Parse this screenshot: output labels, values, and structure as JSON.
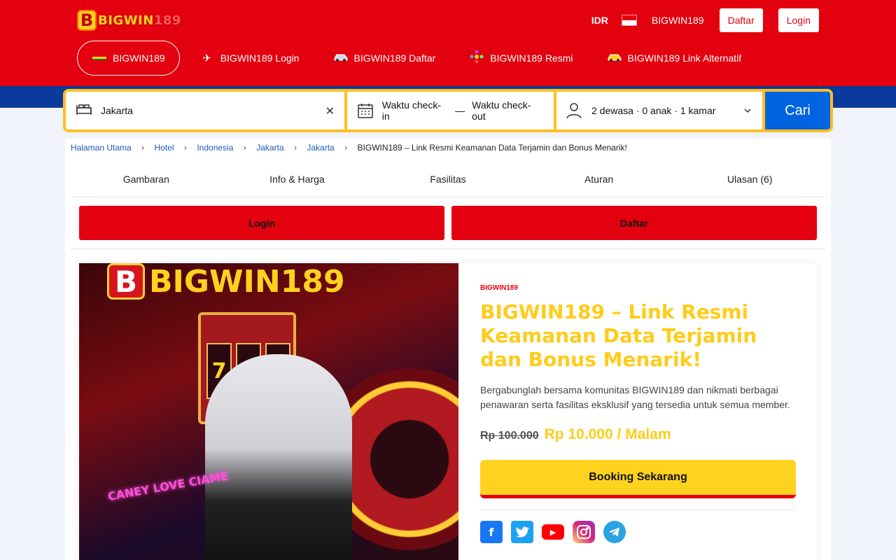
{
  "header": {
    "logo_text": "BIGWIN",
    "logo_number": "189",
    "currency": "IDR",
    "site_name": "BIGWIN189",
    "daftar_label": "Daftar",
    "login_label": "Login",
    "background_color": "#e3000f"
  },
  "nav": {
    "items": [
      {
        "label": "BIGWIN189",
        "icon": "flag-icon",
        "active": true
      },
      {
        "label": "BIGWIN189 Login",
        "icon": "airplane-icon"
      },
      {
        "label": "BIGWIN189 Daftar",
        "icon": "car-icon"
      },
      {
        "label": "BIGWIN189 Resmi",
        "icon": "sparkle-icon"
      },
      {
        "label": "BIGWIN189 Link Alternatif",
        "icon": "taxi-icon"
      }
    ]
  },
  "search": {
    "location": "Jakarta",
    "checkin": "Waktu check-in",
    "separator": "—",
    "checkout": "Waktu check-out",
    "guests": "2 dewasa · 0 anak · 1 kamar",
    "button_label": "Cari",
    "border_color": "#ffbf1f",
    "button_color": "#0064e0"
  },
  "breadcrumb": {
    "items": [
      "Halaman Utama",
      "Hotel",
      "Indonesia",
      "Jakarta",
      "Jakarta"
    ],
    "current": "BIGWIN189 – Link Resmi Keamanan Data Terjamin dan Bonus Menarik!"
  },
  "tabs": [
    "Gambaran",
    "Info & Harga",
    "Fasilitas",
    "Aturan",
    "Ulasan (6)"
  ],
  "actions": {
    "login_label": "Login",
    "daftar_label": "Daftar"
  },
  "hero": {
    "logo_mark": "B",
    "logo_text": "BIGWIN189",
    "neon_text": "CANEY LOVE CIAME"
  },
  "product": {
    "brand": "BIGWIN189",
    "title": "BIGWIN189 – Link Resmi Keamanan Data Terjamin dan Bonus Menarik!",
    "description": "Bergabunglah bersama komunitas BIGWIN189 dan nikmati berbagai penawaran serta fasilitas eksklusif yang tersedia untuk semua member.",
    "old_price": "Rp 100.000",
    "new_price": "Rp 10.000 / Malam",
    "book_label": "Booking Sekarang",
    "accent_color": "#ffcc1a"
  },
  "socials": [
    {
      "name": "facebook-icon",
      "glyph": "f"
    },
    {
      "name": "twitter-icon",
      "glyph": "t"
    },
    {
      "name": "youtube-icon",
      "glyph": "▶"
    },
    {
      "name": "instagram-icon",
      "glyph": "◎"
    },
    {
      "name": "telegram-icon",
      "glyph": "➤"
    }
  ]
}
